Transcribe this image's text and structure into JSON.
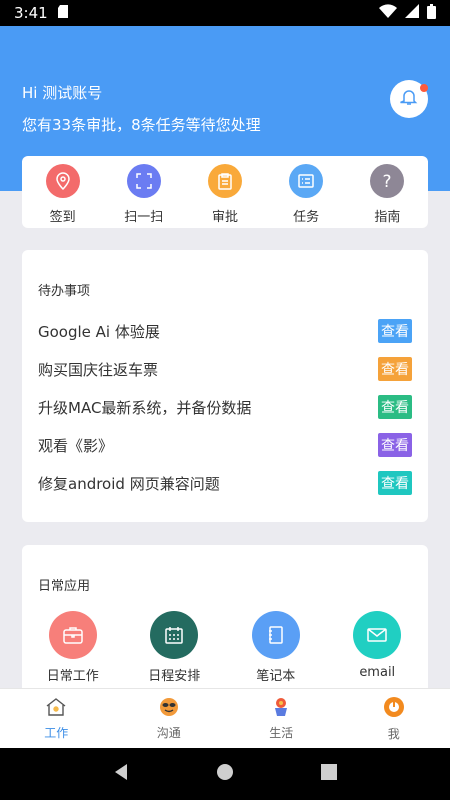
{
  "status": {
    "time": "3:41"
  },
  "header": {
    "greeting": "Hi 测试账号",
    "summary": "您有33条审批，8条任务等待您处理"
  },
  "quick_actions": [
    {
      "label": "签到",
      "icon": "location-pin-icon",
      "color": "#f36b6b"
    },
    {
      "label": "扫一扫",
      "icon": "scan-icon",
      "color": "#6b7cf2"
    },
    {
      "label": "审批",
      "icon": "clipboard-icon",
      "color": "#f9a93a"
    },
    {
      "label": "任务",
      "icon": "task-list-icon",
      "color": "#5aa8f5"
    },
    {
      "label": "指南",
      "icon": "question-icon",
      "color": "#8e8796"
    }
  ],
  "todo": {
    "title": "待办事项",
    "items": [
      {
        "text": "Google Ai 体验展",
        "button": "查看",
        "color": "#4ba3f6"
      },
      {
        "text": "购买国庆往返车票",
        "button": "查看",
        "color": "#f5a23a"
      },
      {
        "text": "升级MAC最新系统，并备份数据",
        "button": "查看",
        "color": "#2bbc84"
      },
      {
        "text": "观看《影》",
        "button": "查看",
        "color": "#8a62e6"
      },
      {
        "text": "修复android 网页兼容问题",
        "button": "查看",
        "color": "#1fc7c0"
      }
    ]
  },
  "apps": {
    "title": "日常应用",
    "items": [
      {
        "label": "日常工作",
        "icon": "briefcase-icon",
        "color": "#f77f7a"
      },
      {
        "label": "日程安排",
        "icon": "calendar-icon",
        "color": "#246b60"
      },
      {
        "label": "笔记本",
        "icon": "notebook-icon",
        "color": "#5a9ff5"
      },
      {
        "label": "email",
        "icon": "mail-icon",
        "color": "#20cfc2"
      }
    ]
  },
  "tabs": [
    {
      "label": "工作",
      "active": true
    },
    {
      "label": "沟通",
      "active": false
    },
    {
      "label": "生活",
      "active": false
    },
    {
      "label": "我",
      "active": false
    }
  ]
}
